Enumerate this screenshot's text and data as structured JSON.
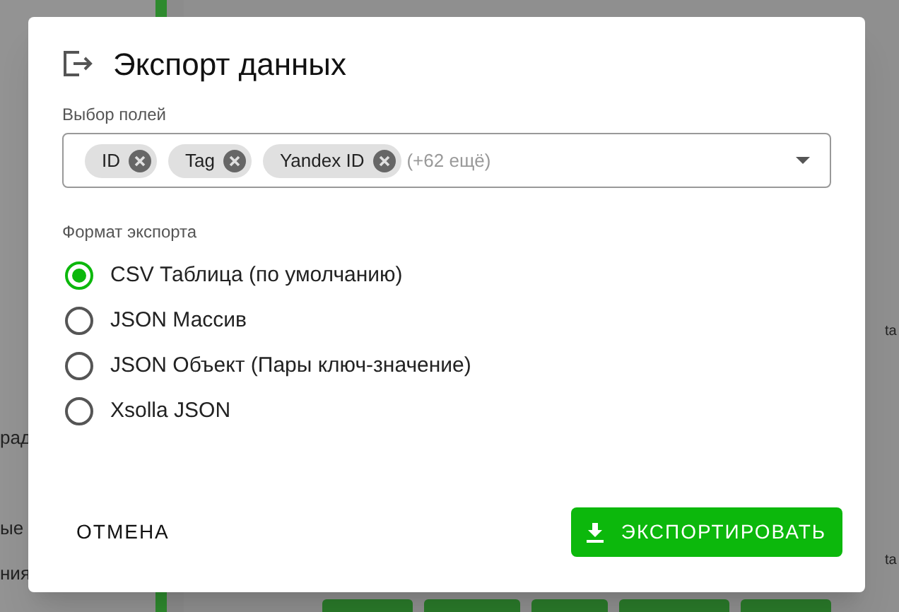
{
  "background": {
    "left_fragments": [
      "рад",
      "ые",
      "ния"
    ],
    "right_fragments": [
      "ta",
      "ta"
    ]
  },
  "dialog": {
    "title": "Экспорт данных",
    "fields": {
      "label": "Выбор полей",
      "chips": [
        "ID",
        "Tag",
        "Yandex ID"
      ],
      "more": "(+62 ещё)"
    },
    "format": {
      "label": "Формат экспорта",
      "options": [
        {
          "label": "CSV Таблица (по умолчанию)",
          "selected": true
        },
        {
          "label": "JSON Массив",
          "selected": false
        },
        {
          "label": "JSON Объект (Пары ключ-значение)",
          "selected": false
        },
        {
          "label": "Xsolla JSON",
          "selected": false
        }
      ]
    },
    "buttons": {
      "cancel": "ОТМЕНА",
      "export": "ЭКСПОРТИРОВАТЬ"
    }
  }
}
